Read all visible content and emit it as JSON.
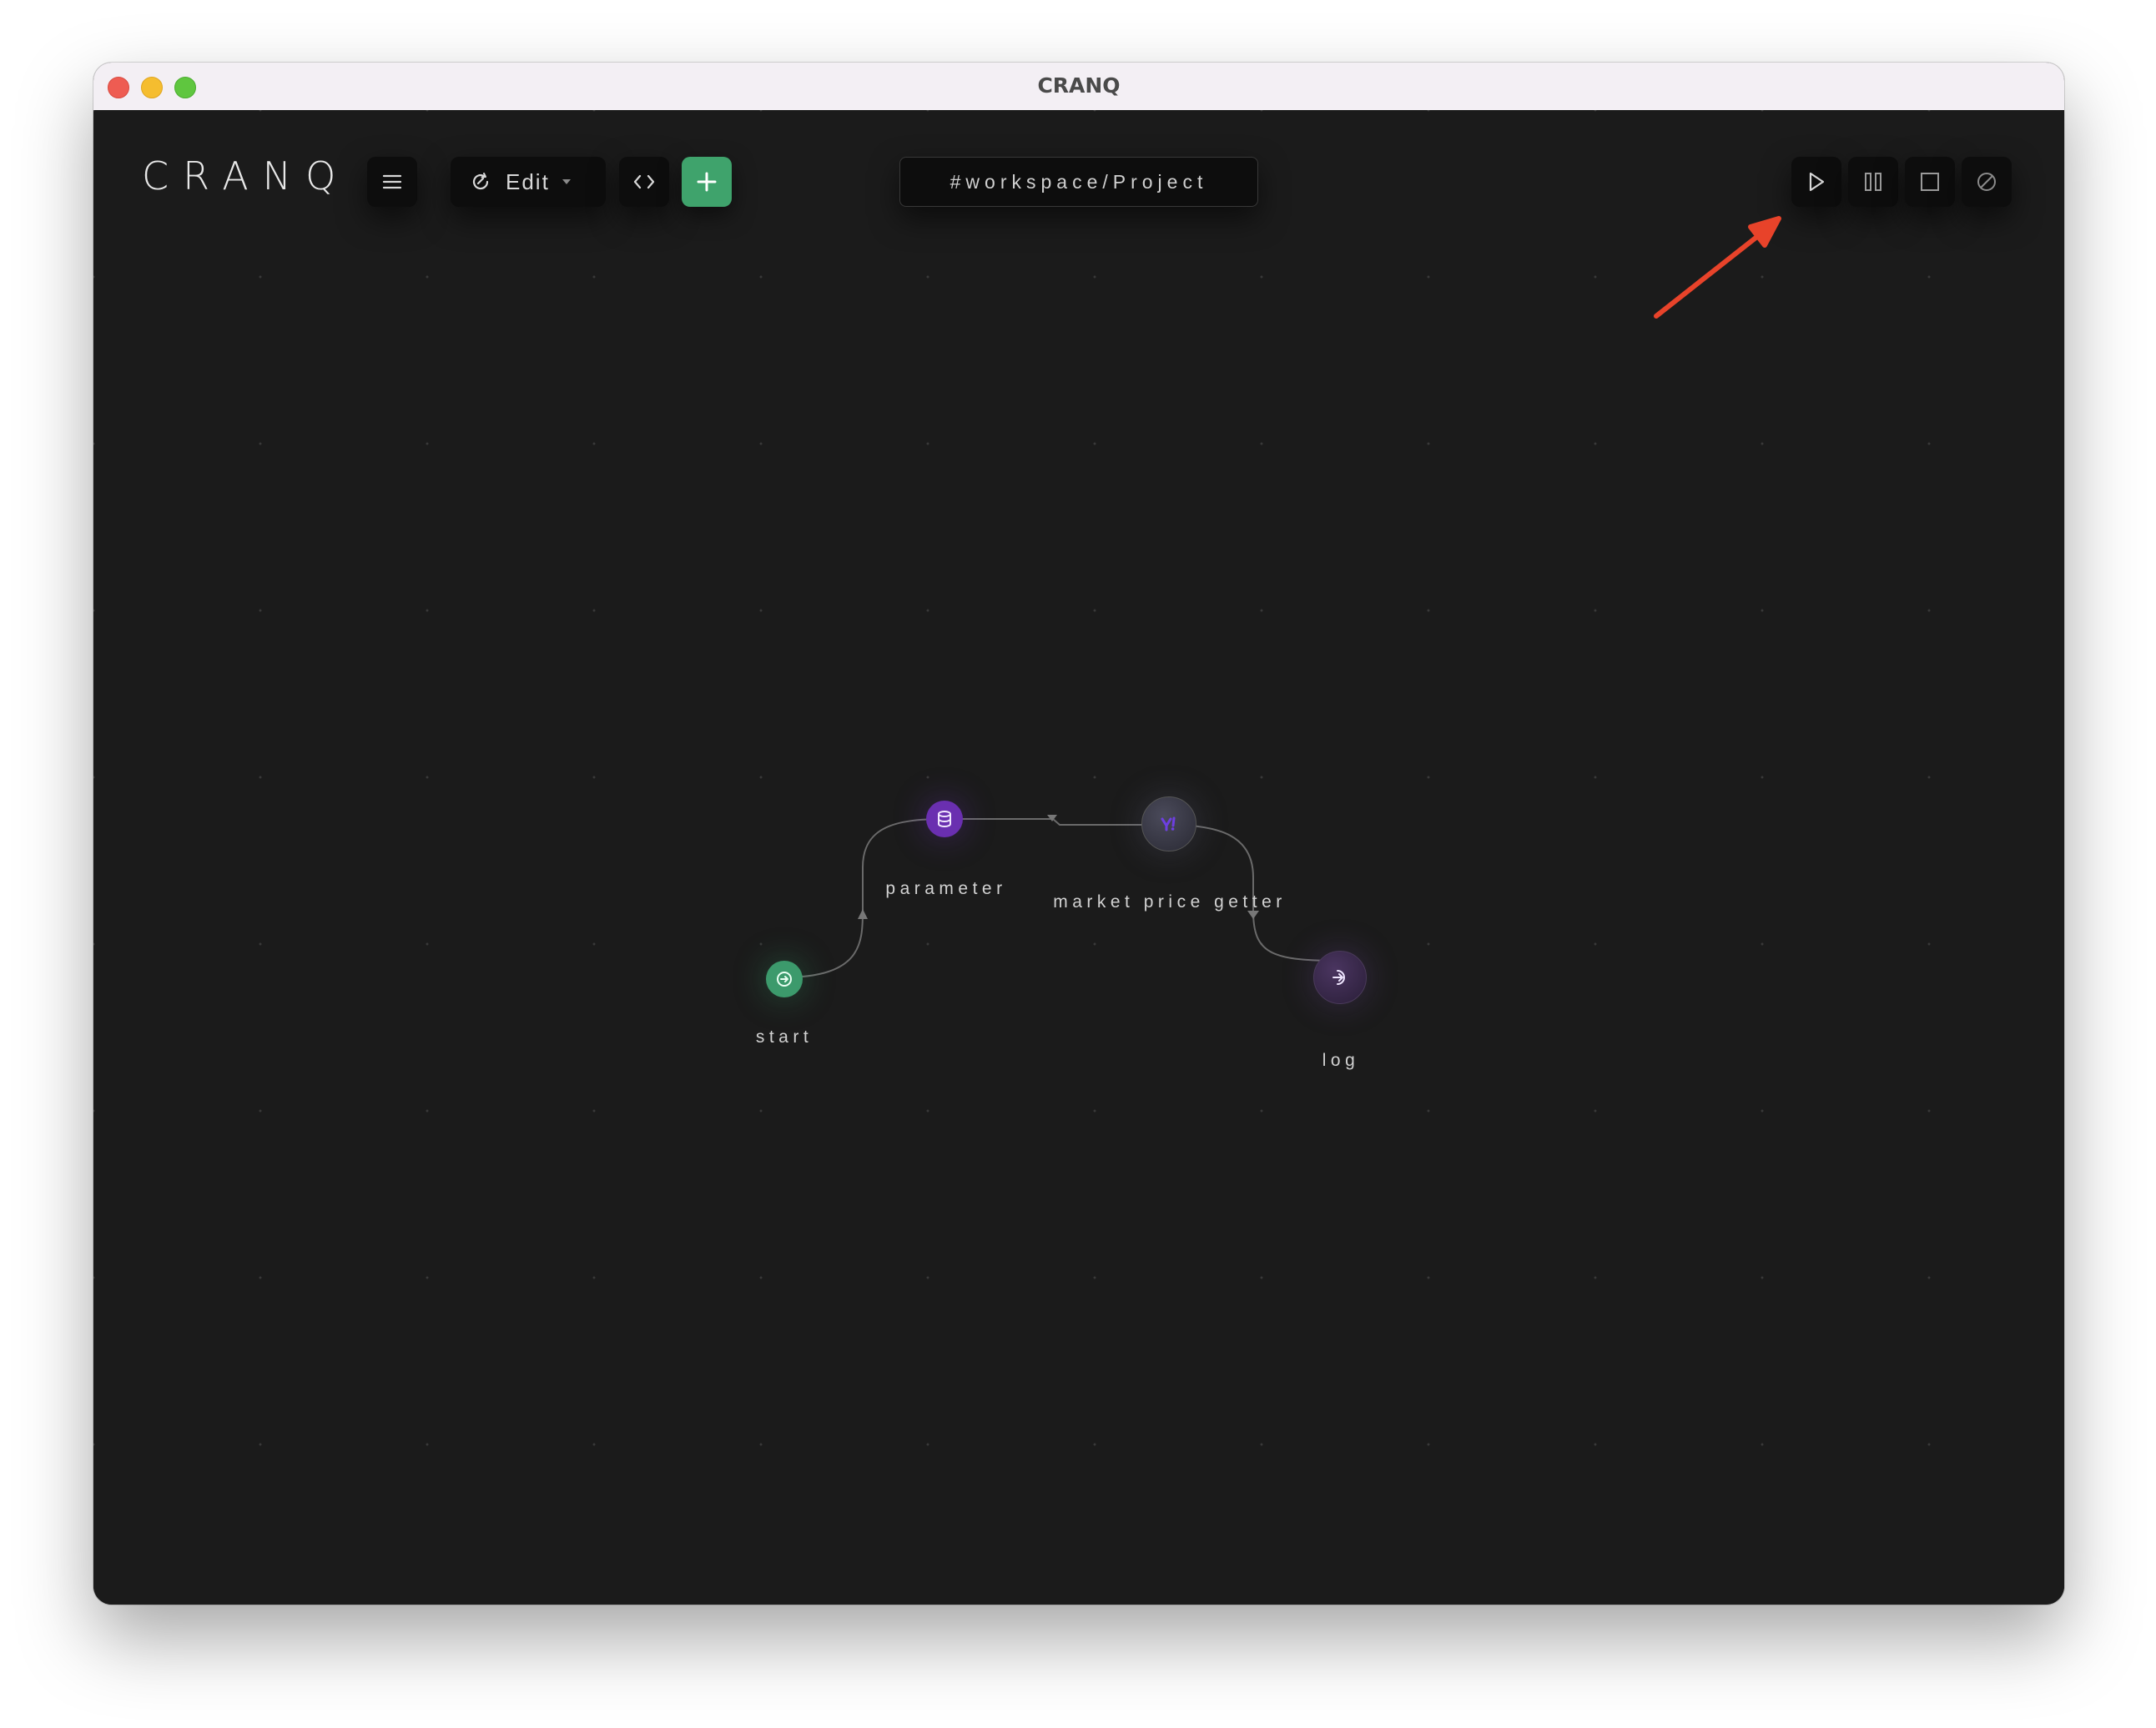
{
  "window": {
    "title": "CRANQ"
  },
  "toolbar": {
    "logo": "CRANQ",
    "menu_icon": "hamburger-icon",
    "mode_label": "Edit",
    "mode_icon": "refresh-edit-icon",
    "code_icon": "code-icon",
    "add_icon": "plus-icon"
  },
  "breadcrumb": {
    "path": "#workspace/Project"
  },
  "controls": {
    "play_icon": "play-icon",
    "pause_icon": "pause-icon",
    "stop_icon": "stop-icon",
    "cancel_icon": "cancel-icon"
  },
  "graph": {
    "nodes": [
      {
        "id": "start",
        "label": "start",
        "icon": "start-icon",
        "color": "#3c9a6c"
      },
      {
        "id": "parameter",
        "label": "parameter",
        "icon": "database-icon",
        "color": "#6a2fb0"
      },
      {
        "id": "market",
        "label": "market price getter",
        "icon": "yahoo-icon",
        "color": "#3a3a4a"
      },
      {
        "id": "log",
        "label": "log",
        "icon": "login-icon",
        "color": "#3a2a4e"
      }
    ],
    "edges": [
      {
        "from": "start",
        "to": "parameter"
      },
      {
        "from": "parameter",
        "to": "market"
      },
      {
        "from": "market",
        "to": "log"
      }
    ]
  },
  "annotation": {
    "arrow_color": "#e8432a"
  }
}
